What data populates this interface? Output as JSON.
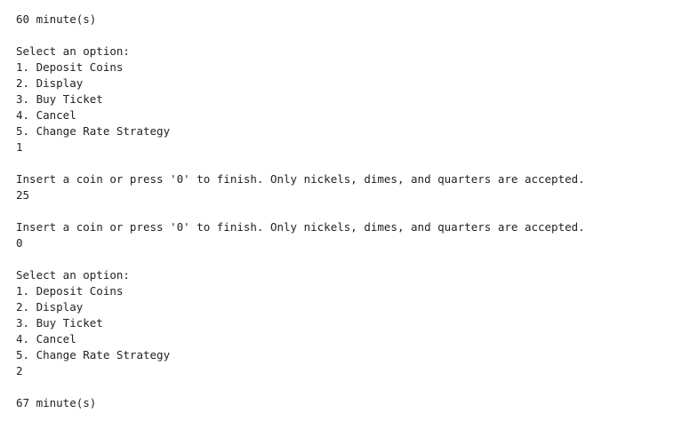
{
  "console": {
    "lines": [
      "60 minute(s)",
      "",
      "Select an option:",
      "1. Deposit Coins",
      "2. Display",
      "3. Buy Ticket",
      "4. Cancel",
      "5. Change Rate Strategy",
      "1",
      "",
      "Insert a coin or press '0' to finish. Only nickels, dimes, and quarters are accepted.",
      "25",
      "",
      "Insert a coin or press '0' to finish. Only nickels, dimes, and quarters are accepted.",
      "0",
      "",
      "Select an option:",
      "1. Deposit Coins",
      "2. Display",
      "3. Buy Ticket",
      "4. Cancel",
      "5. Change Rate Strategy",
      "2",
      "",
      "67 minute(s)"
    ]
  }
}
